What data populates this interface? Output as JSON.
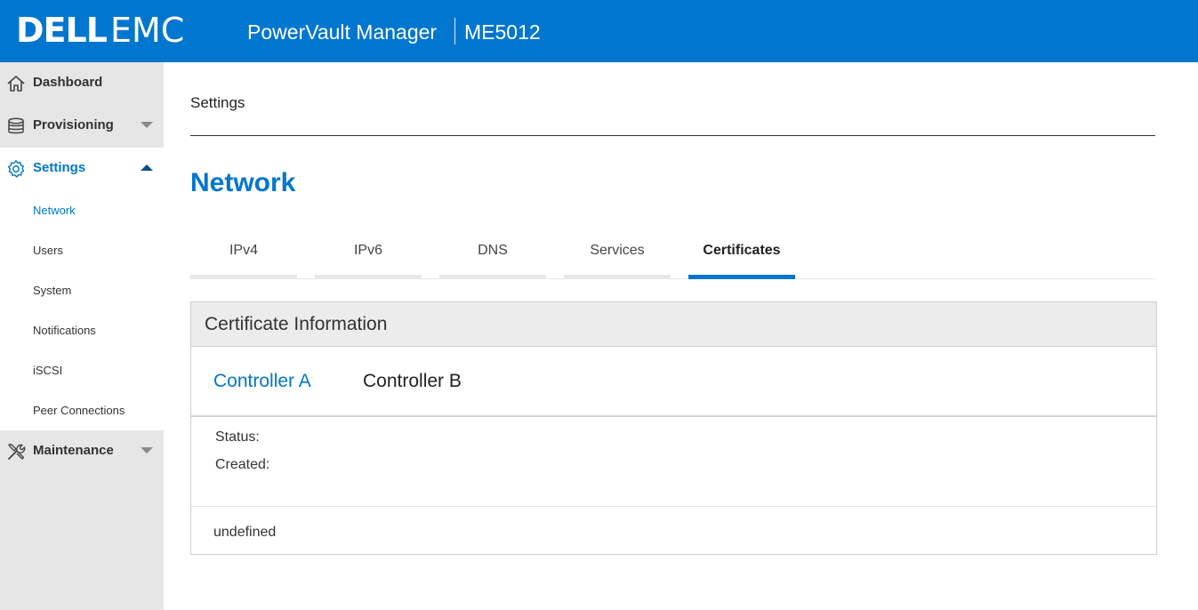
{
  "header": {
    "logo_dell": "DELL",
    "logo_emc": "EMC",
    "app_title": "PowerVault Manager",
    "model": "ME5012",
    "bg_color": "#0076ce"
  },
  "sidebar": {
    "items": [
      {
        "label": "Dashboard",
        "icon": "home-icon"
      },
      {
        "label": "Provisioning",
        "icon": "database-icon",
        "caret": "down"
      },
      {
        "label": "Settings",
        "icon": "gear-icon",
        "caret": "up",
        "active": true
      },
      {
        "label": "Maintenance",
        "icon": "tools-icon",
        "caret": "down"
      }
    ],
    "settings_sub": [
      {
        "label": "Network",
        "active": true
      },
      {
        "label": "Users"
      },
      {
        "label": "System"
      },
      {
        "label": "Notifications"
      },
      {
        "label": "iSCSI"
      },
      {
        "label": "Peer Connections"
      }
    ]
  },
  "main": {
    "breadcrumb": "Settings",
    "page_title": "Network",
    "tabs": [
      {
        "label": "IPv4"
      },
      {
        "label": "IPv6"
      },
      {
        "label": "DNS"
      },
      {
        "label": "Services"
      },
      {
        "label": "Certificates",
        "active": true
      }
    ],
    "panel": {
      "title": "Certificate Information",
      "controllers": [
        {
          "label": "Controller A",
          "active": true
        },
        {
          "label": "Controller B"
        }
      ],
      "fields": [
        {
          "label": "Status:"
        },
        {
          "label": "Created:"
        }
      ],
      "footer_text": "undefined"
    }
  },
  "colors": {
    "accent": "#0076ce",
    "sidebar_bg": "#e6e6e6",
    "panel_header_bg": "#ececec"
  }
}
